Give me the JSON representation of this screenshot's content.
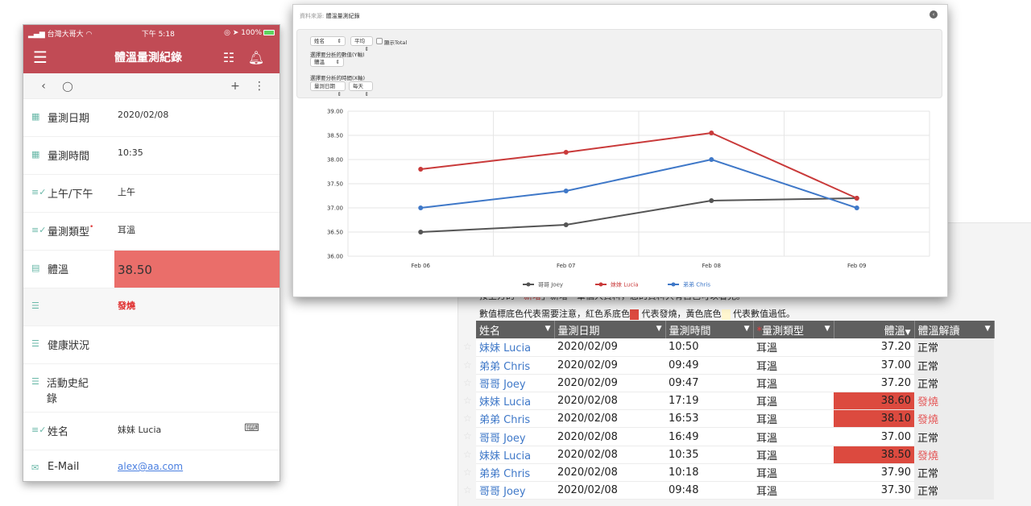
{
  "phone": {
    "status": {
      "carrier": "台灣大哥大",
      "time": "下午 5:18",
      "battery": "100%"
    },
    "header": {
      "title": "體溫量測紀錄",
      "menu_icon": "hamburger-icon",
      "checklist_icon": "checklist-icon",
      "bell_icon": "bell-icon"
    },
    "toolbar": {
      "back": "‹",
      "comment": "💬",
      "add": "+",
      "more": "⋮"
    },
    "fields": {
      "date": {
        "label": "量測日期",
        "value": "2020/02/08"
      },
      "time": {
        "label": "量測時間",
        "value": "10:35"
      },
      "ampm": {
        "label": "上午/下午",
        "value": "上午"
      },
      "type": {
        "label": "量測類型",
        "value": "耳溫",
        "required": "•"
      },
      "temp": {
        "label": "體溫",
        "value": "38.50"
      },
      "interp": {
        "label": "",
        "value": "發燒"
      },
      "health": {
        "label": "健康狀況",
        "value": ""
      },
      "activity": {
        "label": "活動史紀錄",
        "value": ""
      },
      "name": {
        "label": "姓名",
        "value": "妹妹 Lucia"
      },
      "email": {
        "label": "E-Mail",
        "value": "alex@aa.com"
      }
    }
  },
  "popup": {
    "source_label": "資料來源:",
    "source_value": "體溫量測紀錄",
    "controls": {
      "group_by": "姓名",
      "aggregate": "平均",
      "show_total": "顯示Total",
      "y_label": "選擇要分析的數值(Y軸)",
      "y_value": "體溫",
      "x_label": "選擇要分析的時間(X軸)",
      "x_field": "量測日期",
      "x_interval": "每天"
    }
  },
  "chart_data": {
    "type": "line",
    "title": "",
    "xlabel": "",
    "ylabel": "",
    "categories": [
      "Feb 06",
      "Feb 07",
      "Feb 08",
      "Feb 09"
    ],
    "ylim": [
      36.0,
      39.0
    ],
    "yticks": [
      "36.00",
      "36.50",
      "37.00",
      "37.50",
      "38.00",
      "38.50",
      "39.00"
    ],
    "grid": true,
    "legend_position": "bottom",
    "series": [
      {
        "name": "哥哥 Joey",
        "color": "#555555",
        "values": [
          36.5,
          36.65,
          37.15,
          37.2
        ]
      },
      {
        "name": "妹妹 Lucia",
        "color": "#c93a3a",
        "values": [
          37.8,
          38.15,
          38.55,
          37.2
        ]
      },
      {
        "name": "弟弟 Chris",
        "color": "#3f78c8",
        "values": [
          37.0,
          37.35,
          38.0,
          37.0
        ]
      }
    ]
  },
  "table": {
    "notice1_prefix": "按上方的「",
    "notice1_link": "新增",
    "notice1_suffix": "」新增一筆個人資料，您的資料只有自己可以看見。",
    "notice2_a": "數值標底色代表需要注意，紅色系底色",
    "notice2_b": "代表發燒，黃色底色",
    "notice2_c": "代表數值過低。",
    "colors": {
      "fever": "#dc4a3f",
      "low": "#fff6cf",
      "link": "#3f78c8"
    },
    "headers": [
      "姓名",
      "量測日期",
      "量測時間",
      "量測類型",
      "體溫",
      "體溫解讀"
    ],
    "rows": [
      {
        "name": "妹妹 Lucia",
        "date": "2020/02/09",
        "time": "10:50",
        "type": "耳溫",
        "temp": "37.20",
        "interp": "正常"
      },
      {
        "name": "弟弟 Chris",
        "date": "2020/02/09",
        "time": "09:49",
        "type": "耳溫",
        "temp": "37.00",
        "interp": "正常"
      },
      {
        "name": "哥哥 Joey",
        "date": "2020/02/09",
        "time": "09:47",
        "type": "耳溫",
        "temp": "37.20",
        "interp": "正常"
      },
      {
        "name": "妹妹 Lucia",
        "date": "2020/02/08",
        "time": "17:19",
        "type": "耳溫",
        "temp": "38.60",
        "interp": "發燒"
      },
      {
        "name": "弟弟 Chris",
        "date": "2020/02/08",
        "time": "16:53",
        "type": "耳溫",
        "temp": "38.10",
        "interp": "發燒"
      },
      {
        "name": "哥哥 Joey",
        "date": "2020/02/08",
        "time": "16:49",
        "type": "耳溫",
        "temp": "37.00",
        "interp": "正常"
      },
      {
        "name": "妹妹 Lucia",
        "date": "2020/02/08",
        "time": "10:35",
        "type": "耳溫",
        "temp": "38.50",
        "interp": "發燒"
      },
      {
        "name": "弟弟 Chris",
        "date": "2020/02/08",
        "time": "10:18",
        "type": "耳溫",
        "temp": "37.90",
        "interp": "正常"
      },
      {
        "name": "哥哥 Joey",
        "date": "2020/02/08",
        "time": "09:48",
        "type": "耳溫",
        "temp": "37.30",
        "interp": "正常"
      }
    ]
  }
}
